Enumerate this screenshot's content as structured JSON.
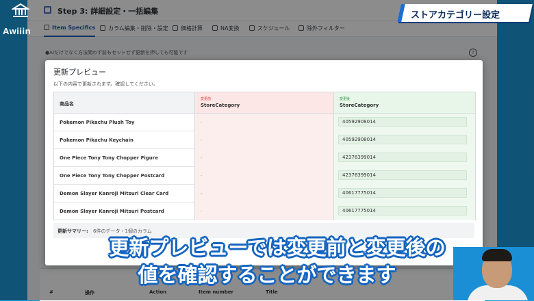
{
  "logo": {
    "text": "Awiiin"
  },
  "banner": {
    "title": "ストアカテゴリー設定"
  },
  "app": {
    "step_title": "Step 3: 詳細設定・一括編集",
    "tabs": [
      {
        "label": "Item Specifics",
        "active": true
      },
      {
        "label": "カラム編集・削除・設定",
        "active": false
      },
      {
        "label": "価格計算",
        "active": false
      },
      {
        "label": "NA変換",
        "active": false
      },
      {
        "label": "スケジュール",
        "active": false
      },
      {
        "label": "除外フィルター",
        "active": false
      }
    ],
    "note": "●AIだけでなく方法問わず前もセットせず更新を押しても可能です",
    "bottom_table_headers": [
      "#",
      "操作",
      "Action",
      "Item number",
      "Title"
    ]
  },
  "modal": {
    "title": "更新プレビュー",
    "subtitle": "以下の内容で更新されます。確認してください。",
    "columns": {
      "name": "商品名",
      "before_tag": "変更前",
      "before_field": "StoreCategory",
      "after_tag": "変更後",
      "after_field": "StoreCategory"
    },
    "rows": [
      {
        "name": "Pokemon Pikachu Plush Toy",
        "before": "-",
        "after": "40592908014"
      },
      {
        "name": "Pokemon Pikachu Keychain",
        "before": "-",
        "after": "40592908014"
      },
      {
        "name": "One Piece Tony Tony Chopper Figure",
        "before": "-",
        "after": "42376399014"
      },
      {
        "name": "One Piece Tony Tony Chopper Postcard",
        "before": "-",
        "after": "42376399014"
      },
      {
        "name": "Demon Slayer Kanroji Mitsuri Clear Card",
        "before": "-",
        "after": "40617775014"
      },
      {
        "name": "Demon Slayer Kanroji Mitsuri Postcard",
        "before": "-",
        "after": "40617775014"
      }
    ],
    "summary_label": "更新サマリー:",
    "summary_text": "6件のデータ・1個のカラム"
  },
  "caption": {
    "line1": "更新プレビューでは変更前と変更後の",
    "line2": "値を確認することができます"
  },
  "colors": {
    "background": "#1d97d8",
    "before_column": "#fde6e6",
    "after_column": "#e7f6e8",
    "caption_outline": "#1565c0"
  }
}
